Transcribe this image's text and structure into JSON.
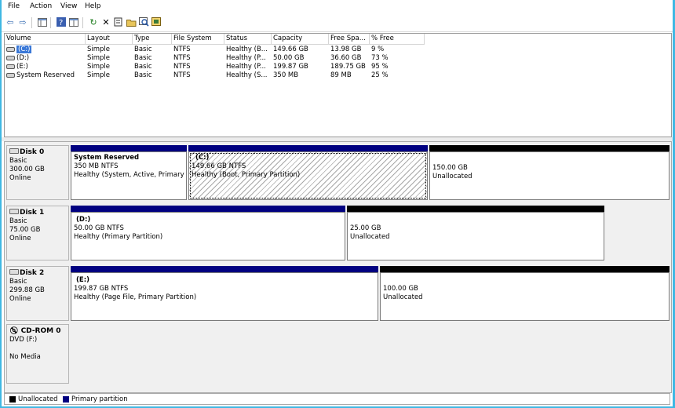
{
  "menu": [
    "File",
    "Action",
    "View",
    "Help"
  ],
  "toolbar_icons": [
    "back-arrow-icon",
    "forward-arrow-icon",
    "console-tree-icon",
    "help-icon",
    "view-icon",
    "refresh-icon",
    "delete-icon",
    "properties-icon",
    "open-icon",
    "explore-icon",
    "rescan-icon"
  ],
  "columns": [
    "Volume",
    "Layout",
    "Type",
    "File System",
    "Status",
    "Capacity",
    "Free Spa...",
    "% Free"
  ],
  "volumes": [
    {
      "name": "(C:)",
      "layout": "Simple",
      "type": "Basic",
      "fs": "NTFS",
      "status": "Healthy (B...",
      "capacity": "149.66 GB",
      "free": "13.98 GB",
      "pct": "9 %"
    },
    {
      "name": "(D:)",
      "layout": "Simple",
      "type": "Basic",
      "fs": "NTFS",
      "status": "Healthy (P...",
      "capacity": "50.00 GB",
      "free": "36.60 GB",
      "pct": "73 %"
    },
    {
      "name": "(E:)",
      "layout": "Simple",
      "type": "Basic",
      "fs": "NTFS",
      "status": "Healthy (P...",
      "capacity": "199.87 GB",
      "free": "189.75 GB",
      "pct": "95 %"
    },
    {
      "name": "System Reserved",
      "layout": "Simple",
      "type": "Basic",
      "fs": "NTFS",
      "status": "Healthy (S...",
      "capacity": "350 MB",
      "free": "89 MB",
      "pct": "25 %"
    }
  ],
  "disks": [
    {
      "title": "Disk 0",
      "kind": "Basic",
      "size": "300.00 GB",
      "state": "Online",
      "partitions": [
        {
          "title": "System Reserved",
          "line1": "350 MB NTFS",
          "line2": "Healthy (System, Active, Primary P"
        },
        {
          "title": "(C:)",
          "line1": "149.66 GB NTFS",
          "line2": "Healthy (Boot, Primary Partition)"
        },
        {
          "title": "",
          "line1": "150.00 GB",
          "line2": "Unallocated"
        }
      ]
    },
    {
      "title": "Disk 1",
      "kind": "Basic",
      "size": "75.00 GB",
      "state": "Online",
      "partitions": [
        {
          "title": "(D:)",
          "line1": "50.00 GB NTFS",
          "line2": "Healthy (Primary Partition)"
        },
        {
          "title": "",
          "line1": "25.00 GB",
          "line2": "Unallocated"
        }
      ]
    },
    {
      "title": "Disk 2",
      "kind": "Basic",
      "size": "299.88 GB",
      "state": "Online",
      "partitions": [
        {
          "title": "(E:)",
          "line1": "199.87 GB NTFS",
          "line2": "Healthy (Page File, Primary Partition)"
        },
        {
          "title": "",
          "line1": "100.00 GB",
          "line2": "Unallocated"
        }
      ]
    },
    {
      "title": "CD-ROM 0",
      "kind": "DVD (F:)",
      "size": "",
      "state": "No Media"
    }
  ],
  "legend": {
    "unallocated": "Unallocated",
    "primary": "Primary partition"
  },
  "colors": {
    "primary": "#000080",
    "unallocated": "#000000",
    "selection": "#3a78d7",
    "desktop": "#3fb8e3"
  }
}
